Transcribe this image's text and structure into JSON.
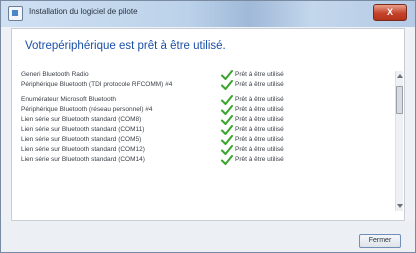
{
  "window": {
    "title": "Installation du logiciel de pilote",
    "close_glyph": "X"
  },
  "heading": "Votrepériphérique est prêt à être utilisé.",
  "devices": [
    {
      "name": "Generi Bluetooth Radio",
      "status": "Prêt à être utilisé"
    },
    {
      "name": "Périphérique Bluetooth (TDI protocole RFCOMM) #4",
      "status": "Prêt à être utilisé"
    },
    {
      "name": "Enumérateur Microsoft Bluetooth",
      "status": "Prêt à être utilisé"
    },
    {
      "name": "Périphérique Bluetooth (réseau personnel) #4",
      "status": "Prêt à être utilisé"
    },
    {
      "name": "Lien série sur Bluetooth standard (COM8)",
      "status": "Prêt à être utilisé"
    },
    {
      "name": "Lien série sur Bluetooth standard (COM11)",
      "status": "Prêt à être utilisé"
    },
    {
      "name": "Lien série sur Bluetooth standard (COM5)",
      "status": "Prêt à être utilisé"
    },
    {
      "name": "Lien série sur Bluetooth standard (COM12)",
      "status": "Prêt à être utilisé"
    },
    {
      "name": "Lien série sur Bluetooth standard (COM14)",
      "status": "Prêt à être utilisé"
    }
  ],
  "footer": {
    "close_label": "Fermer"
  },
  "colors": {
    "heading": "#1b4fa8",
    "check": "#3aa52c"
  }
}
